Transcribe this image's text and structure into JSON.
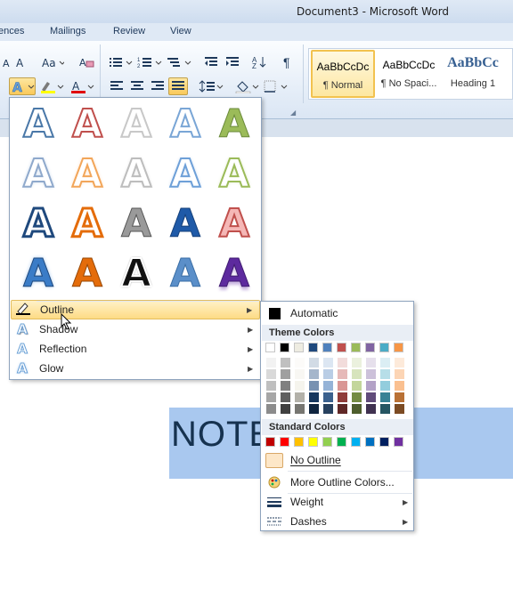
{
  "window": {
    "title": "Document3  -  Microsoft Word"
  },
  "tabs": [
    "ences",
    "Mailings",
    "Review",
    "View"
  ],
  "styles_gallery": [
    {
      "sample": "AaBbCcDc",
      "name": "¶ Normal"
    },
    {
      "sample": "AaBbCcDc",
      "name": "¶ No Spaci..."
    },
    {
      "sample": "AaBbCc",
      "name": "Heading 1"
    }
  ],
  "document": {
    "text": "NOTE               .COM"
  },
  "text_effects_menu": {
    "glyph": "A",
    "items": [
      {
        "label": "Outline",
        "hot": true
      },
      {
        "label": "Shadow"
      },
      {
        "label": "Reflection"
      },
      {
        "label": "Glow"
      }
    ]
  },
  "outline_menu": {
    "automatic_label": "Automatic",
    "theme_colors_label": "Theme Colors",
    "standard_colors_label": "Standard Colors",
    "no_outline_label": "No Outline",
    "more_colors_label": "More Outline Colors...",
    "weight_label": "Weight",
    "dashes_label": "Dashes",
    "theme_colors": [
      "#ffffff",
      "#000000",
      "#eeece1",
      "#1f497d",
      "#4f81bd",
      "#c0504d",
      "#9bbb59",
      "#8064a2",
      "#4bacc6",
      "#f79646"
    ],
    "standard_colors": [
      "#c00000",
      "#ff0000",
      "#ffc000",
      "#ffff00",
      "#92d050",
      "#00b050",
      "#00b0f0",
      "#0070c0",
      "#002060",
      "#7030a0"
    ]
  },
  "colors": {
    "accent_highlight": "#fddb85",
    "selection": "#a9c8ef"
  }
}
